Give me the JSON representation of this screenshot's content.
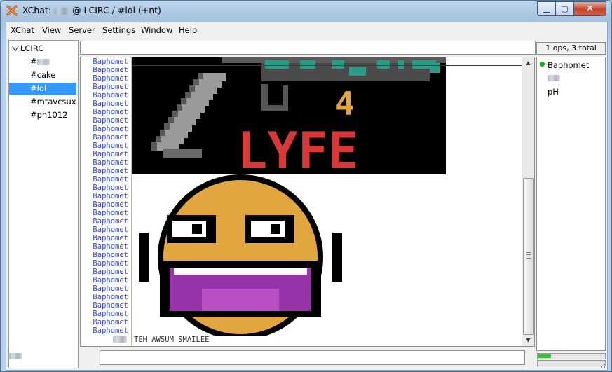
{
  "window": {
    "title_prefix": "XChat:",
    "title_suffix": "@ LCIRC / #lol (+nt)"
  },
  "menu": {
    "items": [
      "XChat",
      "View",
      "Server",
      "Settings",
      "Window",
      "Help"
    ]
  },
  "sidebar": {
    "server": "LCIRC",
    "channels": [
      {
        "label": "#",
        "selected": false
      },
      {
        "label": "#cake",
        "selected": false
      },
      {
        "label": "#lol",
        "selected": true
      },
      {
        "label": "#mtavcsux",
        "selected": false
      },
      {
        "label": "#ph1012",
        "selected": false
      }
    ]
  },
  "chat": {
    "nick": "Baphomet",
    "repeated_lines": 33,
    "art_text_top": "4",
    "art_text_word": "LYFE",
    "last_message": "TEH AWSUM SMAILEE"
  },
  "userlist": {
    "header": "1 ops, 3 total",
    "users": [
      {
        "name": "Baphomet",
        "op": true
      },
      {
        "name": "",
        "op": false
      },
      {
        "name": "pH",
        "op": false
      }
    ]
  },
  "colors": {
    "nick": "#2f49d6",
    "selection": "#3399ff",
    "marker_line": "#c40000",
    "art_red": "#d5393a",
    "art_teal": "#2b9a86",
    "smiley_orange": "#e2a640",
    "mouth_purple": "#9933aa"
  },
  "icons": [
    "xchat-x-icon",
    "expand-triangle-icon",
    "op-status-icon",
    "scroll-up-icon",
    "scroll-down-icon",
    "resize-grip-icon"
  ]
}
